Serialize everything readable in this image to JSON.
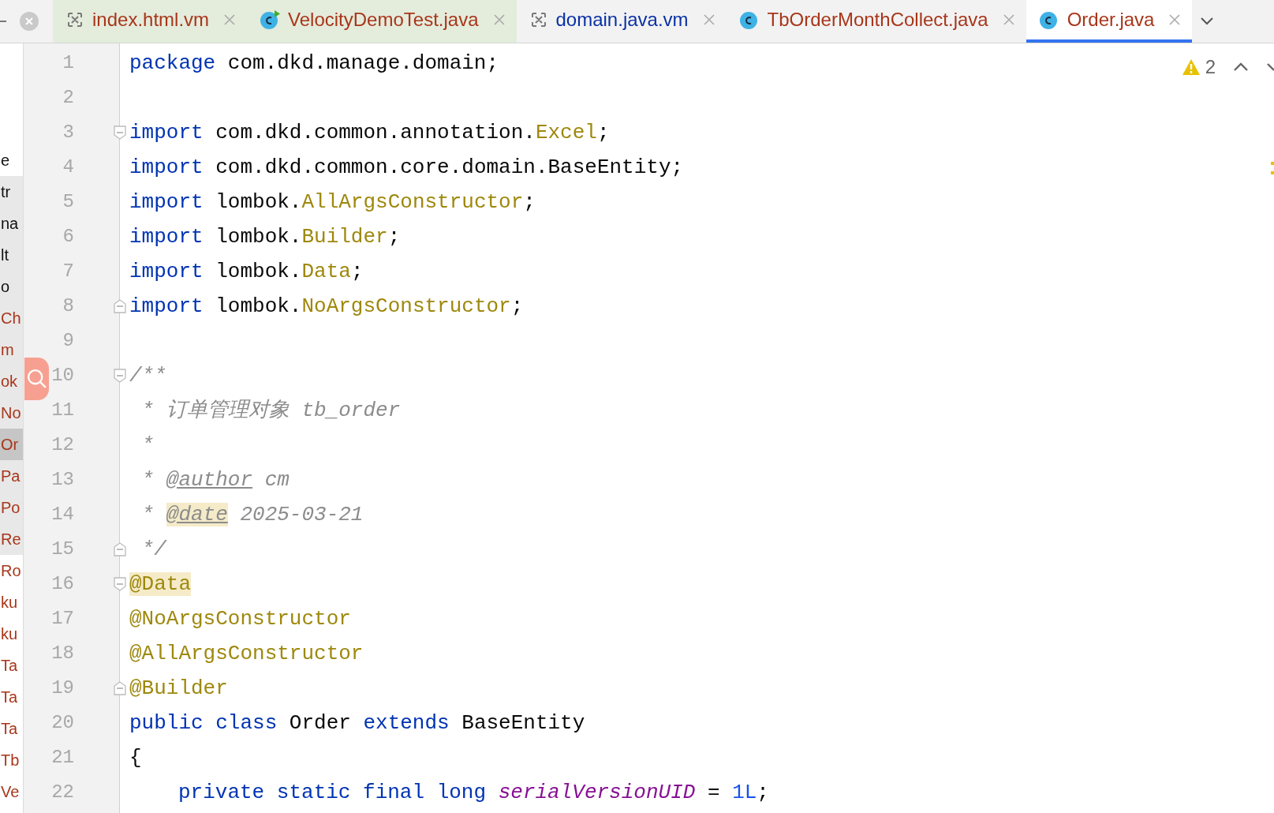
{
  "tabs": [
    {
      "label": "index.html.vm",
      "kind": "template",
      "color": "#a8361a",
      "test": true,
      "selected": false
    },
    {
      "label": "VelocityDemoTest.java",
      "kind": "runnable-class",
      "color": "#a8361a",
      "test": true,
      "selected": false
    },
    {
      "label": "domain.java.vm",
      "kind": "template",
      "color": "#0a32a5",
      "test": false,
      "selected": false
    },
    {
      "label": "TbOrderMonthCollect.java",
      "kind": "class",
      "color": "#a8361a",
      "test": false,
      "selected": false
    },
    {
      "label": "Order.java",
      "kind": "class",
      "color": "#a8361a",
      "test": false,
      "selected": true
    }
  ],
  "project_tree_edge": [
    {
      "text": "e",
      "color": "#111111",
      "highlighted": false,
      "selected": false
    },
    {
      "text": "tr",
      "color": "#111111",
      "highlighted": true,
      "selected": false
    },
    {
      "text": "na",
      "color": "#111111",
      "highlighted": true,
      "selected": false
    },
    {
      "text": "lt",
      "color": "#111111",
      "highlighted": true,
      "selected": false
    },
    {
      "text": "o",
      "color": "#111111",
      "highlighted": true,
      "selected": false
    },
    {
      "text": "Ch",
      "color": "#a8361a",
      "highlighted": true,
      "selected": false
    },
    {
      "text": "m",
      "color": "#a8361a",
      "highlighted": true,
      "selected": false
    },
    {
      "text": "ok",
      "color": "#a8361a",
      "highlighted": true,
      "selected": false
    },
    {
      "text": "No",
      "color": "#a8361a",
      "highlighted": true,
      "selected": false
    },
    {
      "text": "Or",
      "color": "#a8361a",
      "highlighted": true,
      "selected": true
    },
    {
      "text": "Pa",
      "color": "#a8361a",
      "highlighted": true,
      "selected": false
    },
    {
      "text": "Po",
      "color": "#a8361a",
      "highlighted": true,
      "selected": false
    },
    {
      "text": "Re",
      "color": "#a8361a",
      "highlighted": true,
      "selected": false
    },
    {
      "text": "Ro",
      "color": "#a8361a",
      "highlighted": false,
      "selected": false
    },
    {
      "text": "ku",
      "color": "#a8361a",
      "highlighted": false,
      "selected": false
    },
    {
      "text": "ku",
      "color": "#a8361a",
      "highlighted": false,
      "selected": false
    },
    {
      "text": "Ta",
      "color": "#a8361a",
      "highlighted": false,
      "selected": false
    },
    {
      "text": "Ta",
      "color": "#a8361a",
      "highlighted": false,
      "selected": false
    },
    {
      "text": "Ta",
      "color": "#a8361a",
      "highlighted": false,
      "selected": false
    },
    {
      "text": "Tb",
      "color": "#a8361a",
      "highlighted": false,
      "selected": false
    },
    {
      "text": "Ve",
      "color": "#a8361a",
      "highlighted": false,
      "selected": false
    }
  ],
  "inspections": {
    "warnings": "2"
  },
  "code_lines": [
    {
      "number": "1",
      "kind": "plain",
      "indented": false,
      "tokens": [
        {
          "kind": "keyword",
          "text": "package"
        },
        {
          "kind": "plain",
          "text": " com.dkd.manage.domain;"
        }
      ]
    },
    {
      "number": "2",
      "kind": "plain"
    },
    {
      "number": "3",
      "kind": "fold-start",
      "indented": false,
      "tokens": [
        {
          "kind": "keyword",
          "text": "import"
        },
        {
          "kind": "plain",
          "text": " com.dkd.common.annotation."
        },
        {
          "kind": "annotation",
          "text": "Excel"
        },
        {
          "kind": "plain",
          "text": ";"
        }
      ]
    },
    {
      "number": "4",
      "kind": "plain",
      "indented": false,
      "tokens": [
        {
          "kind": "keyword",
          "text": "import"
        },
        {
          "kind": "plain",
          "text": " com.dkd.common.core.domain.BaseEntity;"
        }
      ]
    },
    {
      "number": "5",
      "kind": "plain",
      "indented": false,
      "tokens": [
        {
          "kind": "keyword",
          "text": "import"
        },
        {
          "kind": "plain",
          "text": " lombok."
        },
        {
          "kind": "annotation",
          "text": "AllArgsConstructor"
        },
        {
          "kind": "plain",
          "text": ";"
        }
      ]
    },
    {
      "number": "6",
      "kind": "plain",
      "indented": false,
      "tokens": [
        {
          "kind": "keyword",
          "text": "import"
        },
        {
          "kind": "plain",
          "text": " lombok."
        },
        {
          "kind": "annotation",
          "text": "Builder"
        },
        {
          "kind": "plain",
          "text": ";"
        }
      ]
    },
    {
      "number": "7",
      "kind": "plain",
      "indented": false,
      "tokens": [
        {
          "kind": "keyword",
          "text": "import"
        },
        {
          "kind": "plain",
          "text": " lombok."
        },
        {
          "kind": "annotation",
          "text": "Data"
        },
        {
          "kind": "plain",
          "text": ";"
        }
      ]
    },
    {
      "number": "8",
      "kind": "fold-end",
      "indented": false,
      "tokens": [
        {
          "kind": "keyword",
          "text": "import"
        },
        {
          "kind": "plain",
          "text": " lombok."
        },
        {
          "kind": "annotation",
          "text": "NoArgsConstructor"
        },
        {
          "kind": "plain",
          "text": ";"
        }
      ]
    },
    {
      "number": "9",
      "kind": "plain"
    },
    {
      "number": "10",
      "kind": "fold-start",
      "indented": false,
      "tokens": [
        {
          "kind": "comment",
          "text": "/**"
        }
      ]
    },
    {
      "number": "11",
      "kind": "plain",
      "indented": false,
      "tokens": [
        {
          "kind": "comment",
          "text": " * 订单管理对象 tb_order"
        }
      ]
    },
    {
      "number": "12",
      "kind": "plain",
      "indented": false,
      "tokens": [
        {
          "kind": "comment",
          "text": " *"
        }
      ]
    },
    {
      "number": "13",
      "kind": "plain",
      "indented": false,
      "tokens": [
        {
          "kind": "comment",
          "text": " * "
        },
        {
          "kind": "doctag",
          "text": "@author",
          "highlighted": false
        },
        {
          "kind": "comment",
          "text": " cm"
        }
      ]
    },
    {
      "number": "14",
      "kind": "plain",
      "indented": false,
      "tokens": [
        {
          "kind": "comment",
          "text": " * "
        },
        {
          "kind": "doctag",
          "text": "@date",
          "highlighted": true
        },
        {
          "kind": "comment",
          "text": " 2025-03-21"
        }
      ]
    },
    {
      "number": "15",
      "kind": "fold-end",
      "indented": false,
      "tokens": [
        {
          "kind": "comment",
          "text": " */"
        }
      ]
    },
    {
      "number": "16",
      "kind": "fold-start",
      "indented": false,
      "tokens": [
        {
          "kind": "annotation",
          "text": "@Data",
          "highlighted": true
        }
      ]
    },
    {
      "number": "17",
      "kind": "plain",
      "indented": false,
      "tokens": [
        {
          "kind": "annotation",
          "text": "@NoArgsConstructor"
        }
      ]
    },
    {
      "number": "18",
      "kind": "plain",
      "indented": false,
      "tokens": [
        {
          "kind": "annotation",
          "text": "@AllArgsConstructor"
        }
      ]
    },
    {
      "number": "19",
      "kind": "fold-end",
      "indented": false,
      "tokens": [
        {
          "kind": "annotation",
          "text": "@Builder"
        }
      ]
    },
    {
      "number": "20",
      "kind": "plain",
      "indented": false,
      "tokens": [
        {
          "kind": "keyword",
          "text": "public class"
        },
        {
          "kind": "plain",
          "text": " Order "
        },
        {
          "kind": "keyword",
          "text": "extends"
        },
        {
          "kind": "plain",
          "text": " BaseEntity"
        }
      ]
    },
    {
      "number": "21",
      "kind": "plain",
      "indented": false,
      "tokens": [
        {
          "kind": "plain",
          "text": "{"
        }
      ]
    },
    {
      "number": "22",
      "kind": "plain",
      "indented": true,
      "tokens": [
        {
          "kind": "keyword",
          "text": "private static final long "
        },
        {
          "kind": "field",
          "text": "serialVersionUID"
        },
        {
          "kind": "plain",
          "text": " = "
        },
        {
          "kind": "number",
          "text": "1L"
        },
        {
          "kind": "plain",
          "text": ";"
        }
      ]
    }
  ]
}
